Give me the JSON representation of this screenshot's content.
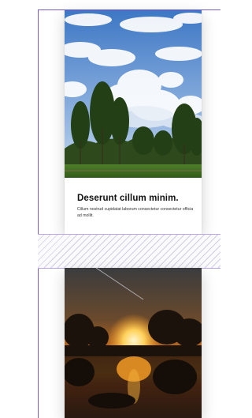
{
  "cards": [
    {
      "title": "Deserunt cillum minim.",
      "text": "Cillum nostrud cupidatat laborum consectetur consectetur officia ad mollit.",
      "image": "landscape-trees-sky"
    },
    {
      "image": "sunset-lake-trees"
    }
  ],
  "colors": {
    "selection_outline": "#7a5cc4",
    "title": "#111111",
    "text": "#333333"
  }
}
